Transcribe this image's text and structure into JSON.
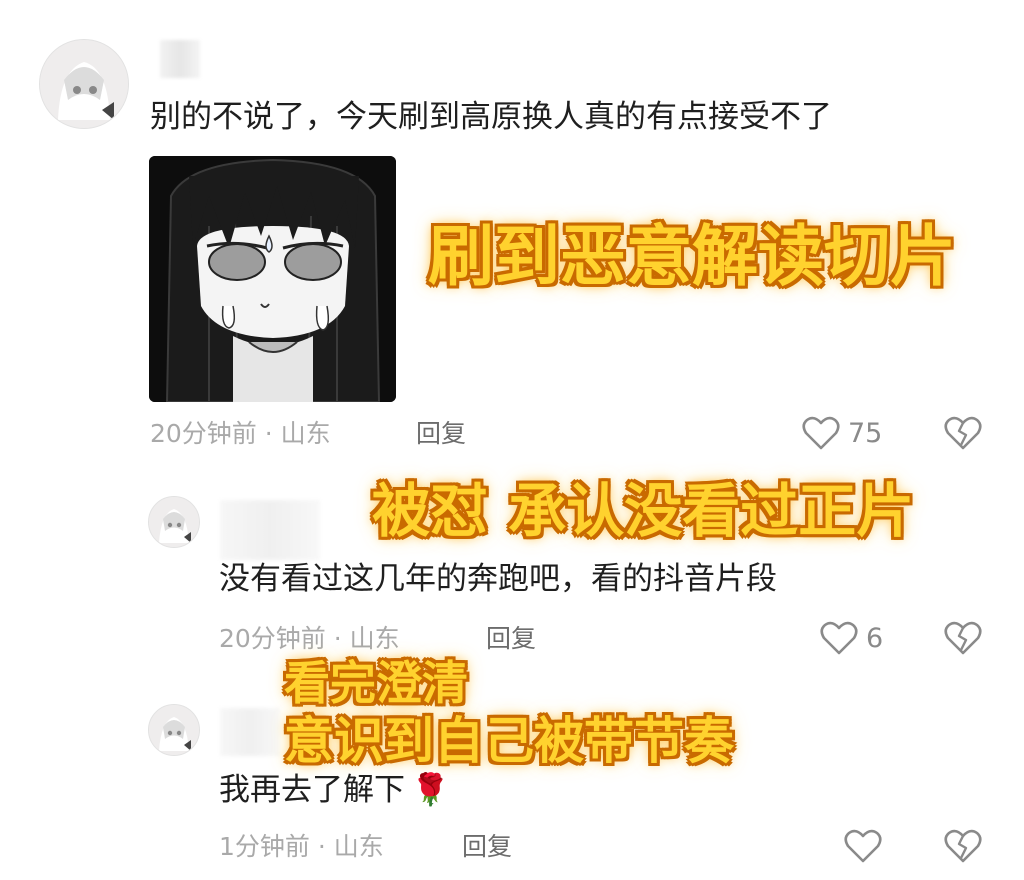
{
  "comments": [
    {
      "text": "别的不说了，今天刷到高原换人真的有点接受不了",
      "time_location": "20分钟前 · 山东",
      "reply_label": "回复",
      "likes": "75"
    },
    {
      "text": "没有看过这几年的奔跑吧，看的抖音片段",
      "time_location": "20分钟前 · 山东",
      "reply_label": "回复",
      "likes": "6"
    },
    {
      "text": "我再去了解下",
      "emoji": "🌹",
      "time_location": "1分钟前 · 山东",
      "reply_label": "回复",
      "likes": ""
    }
  ],
  "overlays": {
    "caption1": "刷到恶意解读切片",
    "caption2": "被怼 承认没看过正片",
    "caption3_line1": "看完澄清",
    "caption3_line2": "意识到自己被带节奏"
  },
  "icons": {
    "like": "heart-outline-icon",
    "dislike": "broken-heart-icon"
  },
  "colors": {
    "overlay_fill": "#ffd22e",
    "overlay_stroke": "#c96a00",
    "meta_text": "#a9a9a9"
  }
}
